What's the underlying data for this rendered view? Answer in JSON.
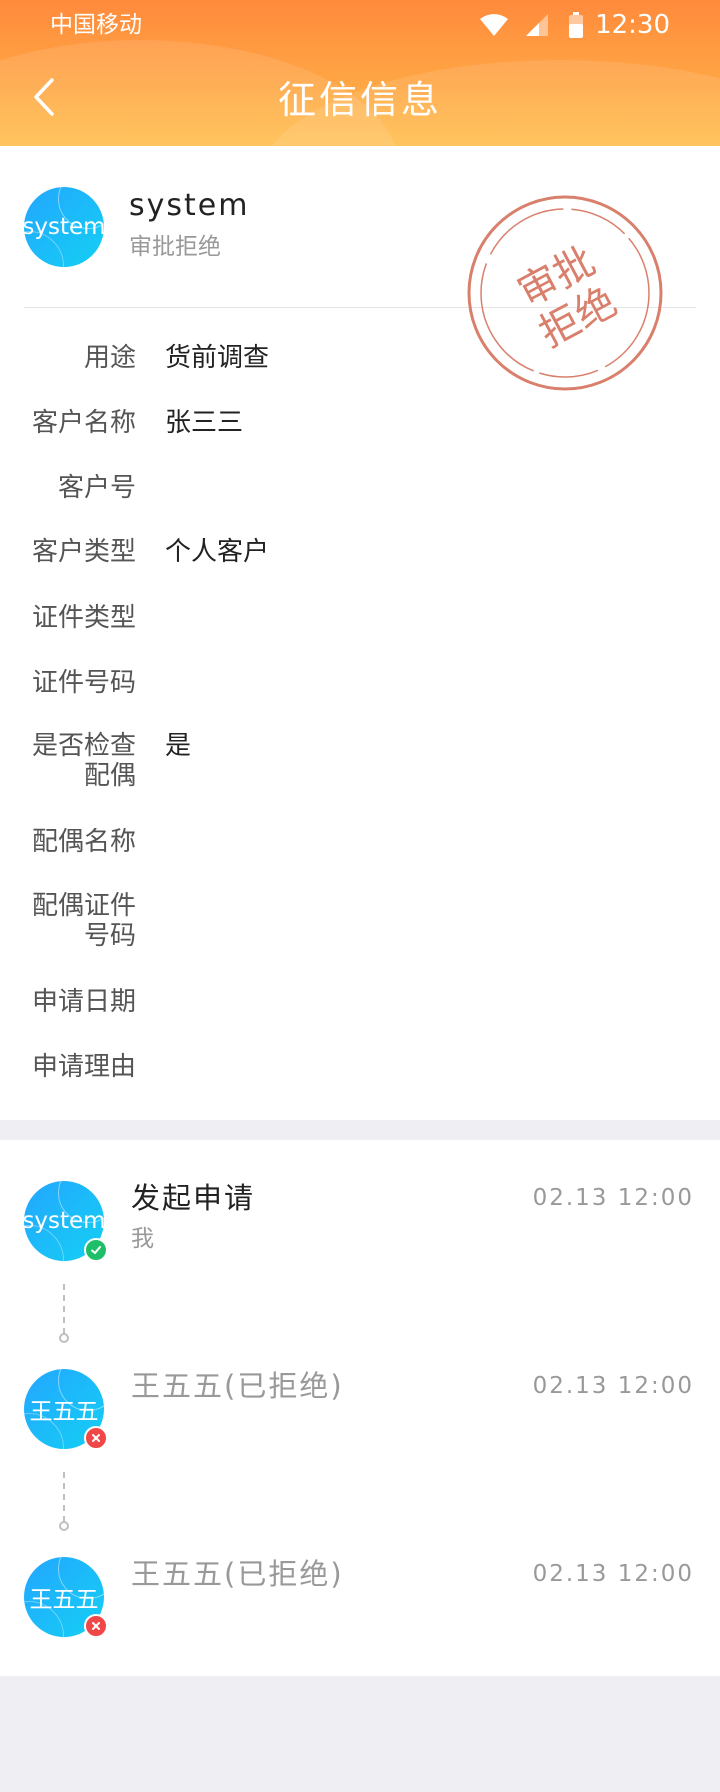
{
  "status_bar": {
    "carrier": "中国移动",
    "time": "12:30"
  },
  "header": {
    "title": "征信信息"
  },
  "applicant": {
    "avatar_text": "system",
    "name": "system",
    "status": "审批拒绝"
  },
  "stamp": {
    "line1": "审批",
    "line2": "拒绝",
    "color": "#d9806d"
  },
  "fields": {
    "purpose": {
      "label": "用途",
      "value": "货前调查"
    },
    "customer_name": {
      "label": "客户名称",
      "value": "张三三"
    },
    "customer_no": {
      "label": "客户号",
      "value": ""
    },
    "customer_type": {
      "label": "客户类型",
      "value": "个人客户"
    },
    "id_type": {
      "label": "证件类型",
      "value": ""
    },
    "id_number": {
      "label": "证件号码",
      "value": ""
    },
    "check_spouse": {
      "label_line1": "是否检查",
      "label_line2": "配偶",
      "value": "是"
    },
    "spouse_name": {
      "label": "配偶名称",
      "value": ""
    },
    "spouse_id": {
      "label_line1": "配偶证件",
      "label_line2": "号码",
      "value": ""
    },
    "apply_date": {
      "label": "申请日期",
      "value": ""
    },
    "apply_reason": {
      "label": "申请理由",
      "value": ""
    }
  },
  "timeline": [
    {
      "avatar_text": "system",
      "title": "发起申请",
      "subtitle": "我",
      "time": "02.13 12:00",
      "result": "approved"
    },
    {
      "avatar_text": "王五五",
      "title": "王五五(已拒绝)",
      "time": "02.13 12:00",
      "result": "rejected"
    },
    {
      "avatar_text": "王五五",
      "title": "王五五(已拒绝)",
      "time": "02.13 12:00",
      "result": "rejected"
    }
  ],
  "colors": {
    "header_orange": "#ff8a3c",
    "header_yellow": "#ffbe4c",
    "avatar_blue": "#23a6ff",
    "approved_green": "#1fbf6a",
    "rejected_red": "#f04848",
    "page_bg": "#efeff3"
  },
  "icons": {
    "back": "chevron-left-icon",
    "wifi": "wifi-icon",
    "signal": "signal-icon",
    "battery": "battery-icon",
    "approved": "check-circle-icon",
    "rejected": "close-circle-icon"
  }
}
